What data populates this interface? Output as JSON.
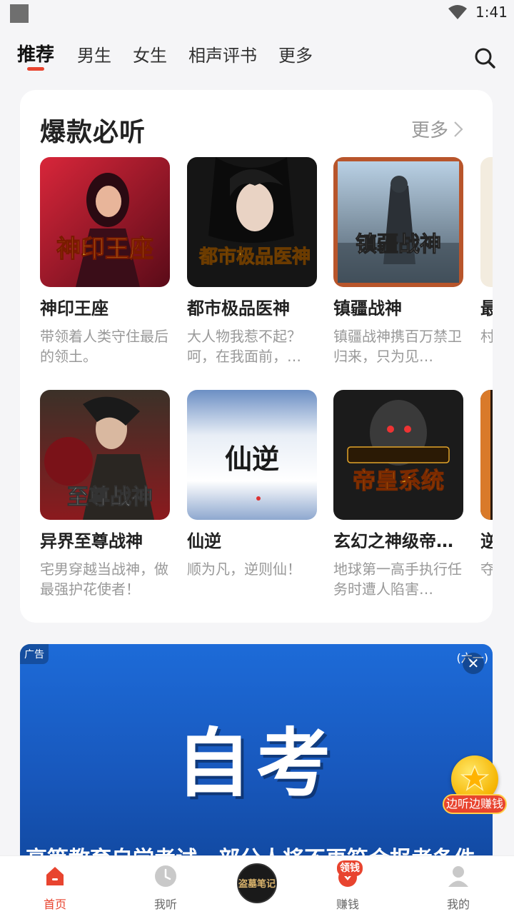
{
  "status_bar": {
    "time": "1:41"
  },
  "top_tabs": [
    {
      "label": "推荐",
      "active": true
    },
    {
      "label": "男生",
      "active": false
    },
    {
      "label": "女生",
      "active": false
    },
    {
      "label": "相声评书",
      "active": false
    },
    {
      "label": "更多",
      "active": false
    }
  ],
  "section": {
    "title": "爆款必听",
    "more_label": "更多",
    "books": [
      {
        "title": "神印王座",
        "desc": "带领着人类守住最后的领土。",
        "cover_text": "神印王座"
      },
      {
        "title": "都市极品医神",
        "desc": "大人物我惹不起？呵，在我面前，…",
        "cover_text": "都市极品医神"
      },
      {
        "title": "镇疆战神",
        "desc": "镇疆战神携百万禁卫归来，只为见…",
        "cover_text": "镇疆战神"
      },
      {
        "title": "最",
        "desc": "村豪",
        "cover_text": ""
      },
      {
        "title": "异界至尊战神",
        "desc": "宅男穿越当战神，做最强护花使者！",
        "cover_text": "至尊战神"
      },
      {
        "title": "仙逆",
        "desc": "顺为凡，逆则仙！",
        "cover_text": "仙逆"
      },
      {
        "title": "玄幻之神级帝…",
        "desc": "地球第一高手执行任务时遭人陷害…",
        "cover_text": "帝皇系统"
      },
      {
        "title": "逆",
        "desc": "夺乱",
        "cover_text": ""
      }
    ]
  },
  "ad": {
    "badge": "广告",
    "corner_text": "(六一)",
    "headline": "自考",
    "subline": "高等教育自学考试，部分人将不再符合报考条件"
  },
  "floating": {
    "label": "边听边赚钱"
  },
  "bottom_nav": {
    "items": [
      {
        "label": "首页",
        "active": true
      },
      {
        "label": "我听",
        "active": false
      },
      {
        "label": "赚钱",
        "active": false
      },
      {
        "label": "我的",
        "active": false
      }
    ],
    "center_text": "盗墓笔记",
    "earn_badge": "领钱"
  },
  "colors": {
    "accent": "#e8442f",
    "ad_blue": "#1d6bd8",
    "muted": "#999999"
  }
}
